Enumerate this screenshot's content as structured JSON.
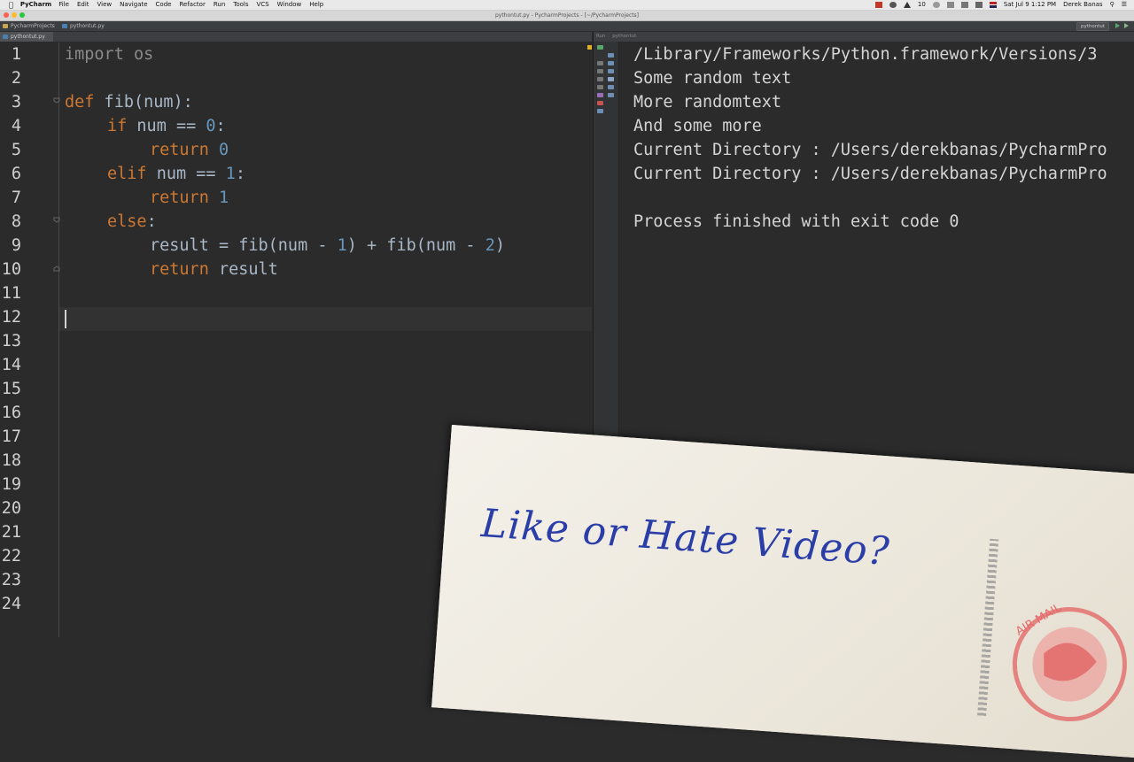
{
  "menubar": {
    "app_name": "PyCharm",
    "items": [
      "File",
      "Edit",
      "View",
      "Navigate",
      "Code",
      "Refactor",
      "Run",
      "Tools",
      "VCS",
      "Window",
      "Help"
    ],
    "clock": "Sat Jul 9  1:12 PM",
    "user": "Derek Banas",
    "battery_count": "10"
  },
  "window": {
    "title": "pythontut.py - PycharmProjects - [~/PycharmProjects]"
  },
  "navbar": {
    "crumb_project": "PycharmProjects",
    "crumb_file": "pythontut.py",
    "run_config": "pythontut"
  },
  "editor": {
    "tab_label": "pythontut.py",
    "line_numbers": [
      "1",
      "2",
      "3",
      "4",
      "5",
      "6",
      "7",
      "8",
      "9",
      "10",
      "11",
      "12",
      "13",
      "14",
      "15",
      "16",
      "17",
      "18",
      "19",
      "20",
      "21",
      "22",
      "23",
      "24"
    ],
    "lines": {
      "l1_kw": "import",
      "l1_mod": " os",
      "l3_kw": "def",
      "l3_rest": " fib(num):",
      "l4_kw": "if",
      "l4_rest": " num == ",
      "l4_num": "0",
      "l4_end": ":",
      "l5_kw": "return",
      "l5_num": " 0",
      "l6_kw": "elif",
      "l6_rest": " num == ",
      "l6_num": "1",
      "l6_end": ":",
      "l7_kw": "return",
      "l7_num": " 1",
      "l8_kw": "else",
      "l8_end": ":",
      "l9_a": "result = fib(num - ",
      "l9_n1": "1",
      "l9_b": ") + fib(num - ",
      "l9_n2": "2",
      "l9_c": ")",
      "l10_kw": "return",
      "l10_rest": " result"
    }
  },
  "run": {
    "header_label": "Run",
    "config_label": "pythontut",
    "output": [
      "/Library/Frameworks/Python.framework/Versions/3",
      "Some random text",
      "More randomtext",
      "And some more",
      "Current Directory : /Users/derekbanas/PycharmPro",
      "Current Directory : /Users/derekbanas/PycharmPro",
      "",
      "Process finished with exit code 0"
    ]
  },
  "overlay": {
    "postcard_text": "Like or Hate Video?",
    "stamp_text": "AIR MAIL"
  },
  "colors": {
    "keyword": "#cc7832",
    "number": "#6897bb",
    "background": "#2b2b2b",
    "ink": "#2b3ea8"
  }
}
